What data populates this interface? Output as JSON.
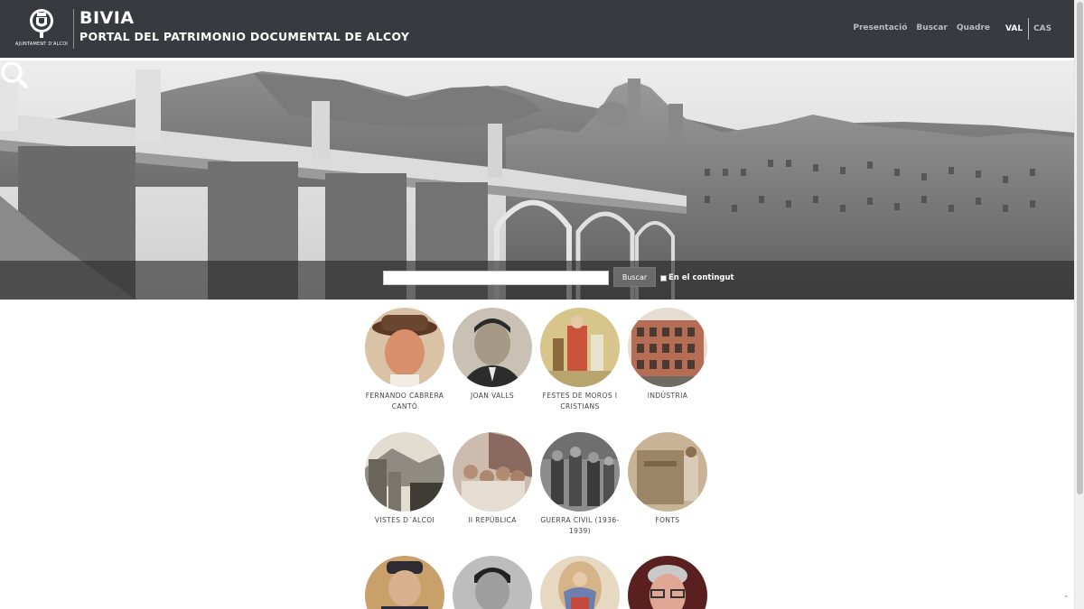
{
  "header": {
    "logo_caption": "AJUNTAMENT D'ALCOI",
    "title": "BIVIA",
    "subtitle": "PORTAL DEL PATRIMONIO DOCUMENTAL DE ALCOY",
    "nav": [
      "Presentació",
      "Buscar",
      "Quadre"
    ],
    "lang_active": "VAL",
    "lang_other": "CAS"
  },
  "search": {
    "placeholder": "",
    "button_label": "Buscar",
    "checkbox_label": "En el contingut"
  },
  "collections": [
    {
      "label": "FERNANDO CABRERA CANTÓ",
      "icon": "portrait-hat"
    },
    {
      "label": "JOAN VALLS",
      "icon": "portrait-man"
    },
    {
      "label": "FESTES DE MOROS I CRISTIANS",
      "icon": "festival"
    },
    {
      "label": "INDÚSTRIA",
      "icon": "factory-building"
    },
    {
      "label": "VISTES D´ALCOI",
      "icon": "town-view"
    },
    {
      "label": "II REPÚBLICA",
      "icon": "group-flag"
    },
    {
      "label": "GUERRA CIVIL (1936-1939)",
      "icon": "soldiers"
    },
    {
      "label": "FONTS",
      "icon": "fountain"
    },
    {
      "label": "",
      "icon": "portrait-officer"
    },
    {
      "label": "",
      "icon": "portrait-man-bw"
    },
    {
      "label": "",
      "icon": "religious-painting"
    },
    {
      "label": "",
      "icon": "portrait-glasses"
    }
  ],
  "colors": {
    "header_bg": "#373a3f",
    "nav_text": "#b8bbbf",
    "caption_text": "#444444",
    "back_to_top": "#d75a4a"
  }
}
